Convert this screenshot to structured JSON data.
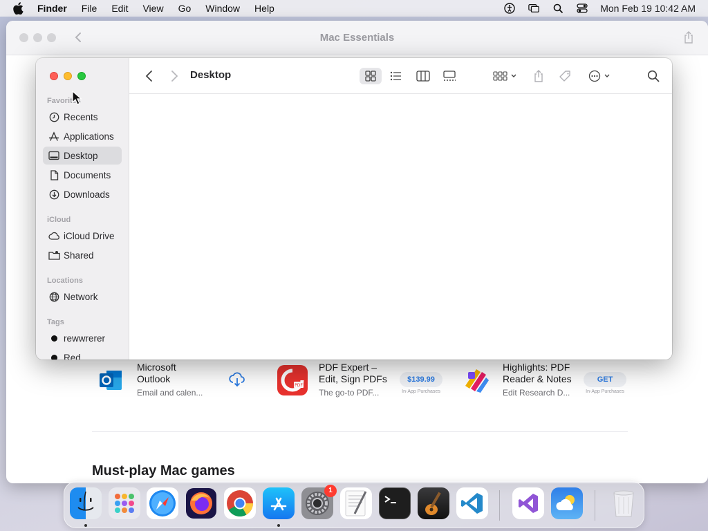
{
  "menubar": {
    "app_name": "Finder",
    "items": [
      "File",
      "Edit",
      "View",
      "Go",
      "Window",
      "Help"
    ],
    "clock": "Mon Feb 19  10:42 AM",
    "status_icons": [
      "accessibility-icon",
      "screen-mirroring-icon",
      "spotlight-icon",
      "control-center-icon"
    ]
  },
  "background_window": {
    "title": "Mac Essentials",
    "apps": [
      {
        "name": "Microsoft\nOutlook",
        "subtitle": "Email and calen...",
        "action": "download",
        "icon": "outlook-icon"
      },
      {
        "name": "PDF Expert –\nEdit, Sign PDFs",
        "subtitle": "The go-to PDF...",
        "action": "$139.99",
        "iap": "In-App Purchases",
        "icon": "pdf-expert-icon"
      },
      {
        "name": "Highlights: PDF\nReader & Notes",
        "subtitle": "Edit Research D...",
        "action": "GET",
        "iap": "In-App Purchases",
        "icon": "highlights-icon"
      }
    ],
    "section_title": "Must-play Mac games"
  },
  "finder": {
    "title": "Desktop",
    "sidebar": {
      "favorites_label": "Favorites",
      "favorites": [
        "Recents",
        "Applications",
        "Desktop",
        "Documents",
        "Downloads"
      ],
      "selected": "Desktop",
      "icloud_label": "iCloud",
      "icloud": [
        "iCloud Drive",
        "Shared"
      ],
      "locations_label": "Locations",
      "locations": [
        "Network"
      ],
      "tags_label": "Tags",
      "tags": [
        "rewwrerer",
        "Red"
      ]
    }
  },
  "dock": {
    "apps": [
      "Finder",
      "Launchpad",
      "Safari",
      "Firefox",
      "Chrome",
      "App Store",
      "System Settings",
      "TextEdit",
      "Terminal",
      "GarageBand",
      "Visual Studio Code",
      "Visual Studio",
      "Weather",
      "Trash"
    ],
    "settings_badge": "1"
  },
  "colors": {
    "accent": "#2a7ae2",
    "selected_sidebar": "#dcdcdf",
    "red_light": "#fe5f57",
    "yellow_light": "#febc2e",
    "green_light": "#28c840"
  }
}
